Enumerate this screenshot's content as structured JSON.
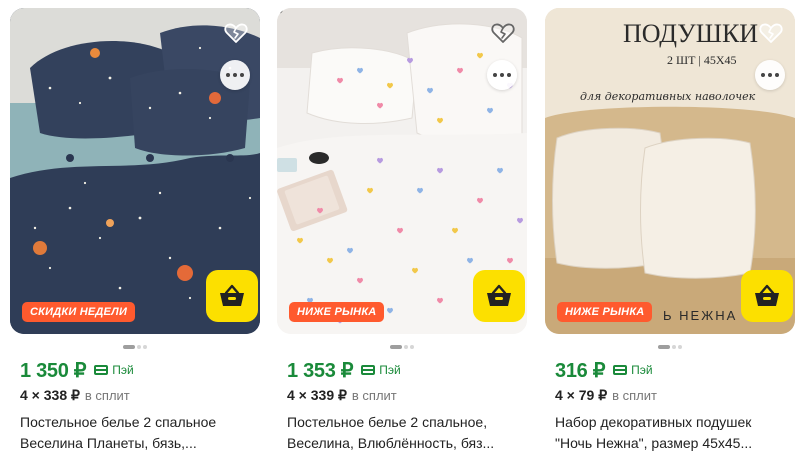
{
  "cards": [
    {
      "badge": "СКИДКИ НЕДЕЛИ",
      "price": "1 350 ₽",
      "pay_label": "Пэй",
      "split_price": "4 × 338 ₽",
      "split_label": "в сплит",
      "title": "Постельное белье 2 спальное\nВеселина Планеты, бязь,..."
    },
    {
      "badge": "НИЖЕ РЫНКА",
      "price": "1 353 ₽",
      "pay_label": "Пэй",
      "split_price": "4 × 339 ₽",
      "split_label": "в сплит",
      "title": "Постельное белье 2 спальное,\nВеселина, Влюблённость, бяз..."
    },
    {
      "badge": "НИЖЕ РЫНКА",
      "price": "316 ₽",
      "pay_label": "Пэй",
      "split_price": "4 × 79 ₽",
      "split_label": "в сплит",
      "title": "Набор декоративных подушек\n\"Ночь Нежна\", размер 45х45...",
      "image_text": {
        "heading": "ПОДУШКИ",
        "sub": "2 ШТ | 45Х45",
        "script": "для декоративных наволочек",
        "bottom": "Ь НЕЖНА"
      }
    }
  ],
  "colors": {
    "price_green": "#1a8a3a",
    "badge_orange": "#ff5a2e",
    "cart_yellow": "#fce000"
  },
  "icons": [
    "heart-broken-icon",
    "more-dots-icon",
    "basket-icon",
    "card-pay-icon"
  ]
}
